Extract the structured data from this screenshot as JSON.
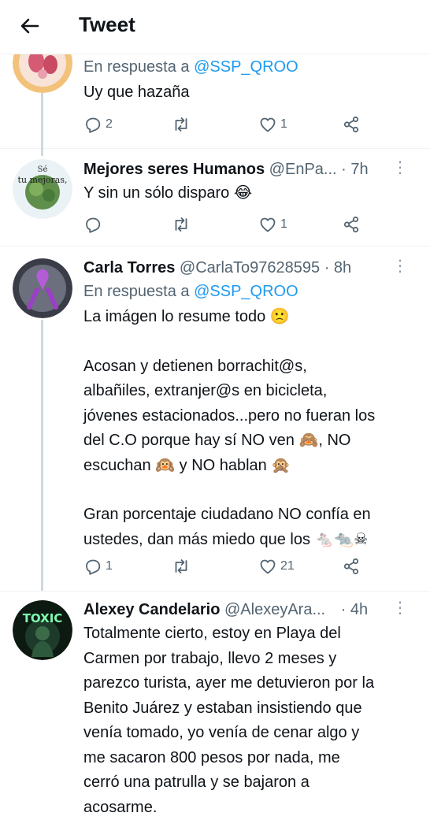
{
  "header": {
    "title": "Tweet",
    "back_icon": "arrow-left-icon"
  },
  "tweets": [
    {
      "name": "",
      "handle": "",
      "time": "",
      "reply_prefix": "En respuesta a",
      "reply_mention": "@SSP_QROO",
      "text": [
        "Uy que hazaña"
      ],
      "actions": {
        "replies": "2",
        "retweets": "",
        "likes": "1"
      }
    },
    {
      "name": "Mejores seres Humanos",
      "handle": "@EnPa...",
      "time": "· 7h",
      "avatar_text": [
        "Sé",
        "tu mejoras,"
      ],
      "text": [
        "Y sin un sólo disparo 😂"
      ],
      "actions": {
        "replies": "",
        "retweets": "",
        "likes": "1"
      }
    },
    {
      "name": "Carla Torres",
      "handle": "@CarlaTo97628595",
      "time": "· 8h",
      "reply_prefix": "En respuesta a",
      "reply_mention": "@SSP_QROO",
      "text": [
        "La imágen lo resume todo 🙁",
        "",
        "Acosan y detienen borrachit@s,",
        "albañiles, extranjer@s en bicicleta,",
        "jóvenes estacionados...pero no fueran los",
        "del C.O porque hay sí NO ven 🙈, NO",
        "escuchan 🙉 y NO hablan 🙊",
        "",
        "Gran porcentaje ciudadano NO confía en",
        "ustedes, dan más miedo que los 🐁🐀☠"
      ],
      "actions": {
        "replies": "1",
        "retweets": "",
        "likes": "21"
      }
    },
    {
      "name": "Alexey Candelario",
      "handle": "@AlexeyAra...",
      "time": "· 4h",
      "avatar_text": "TOXIC",
      "text": [
        "Totalmente cierto, estoy en Playa del",
        "Carmen por trabajo, llevo 2 meses y",
        "parezco turista, ayer me detuvieron por la",
        "Benito Juárez y estaban insistiendo que",
        "venía tomado, yo venía de cenar algo y",
        "me sacaron 800 pesos por nada, me",
        "cerró una patrulla y se bajaron a",
        "acosarme."
      ]
    }
  ],
  "icons": {
    "reply": "reply-icon",
    "retweet": "retweet-icon",
    "like": "heart-icon",
    "share": "share-icon",
    "more": "more-icon"
  },
  "colors": {
    "link": "#1d9bf0",
    "secondary": "#536471",
    "action": "#536471",
    "thread_line": "#cfd9de"
  }
}
